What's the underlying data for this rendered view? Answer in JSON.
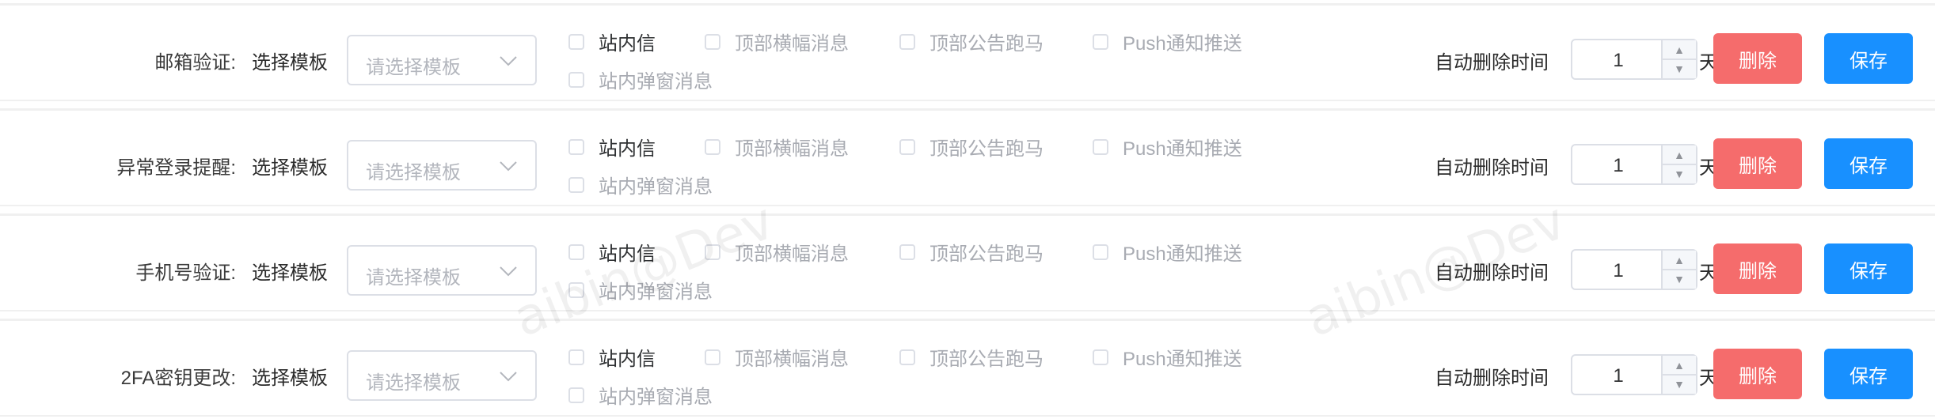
{
  "rows": [
    {
      "label": "邮箱验证:"
    },
    {
      "label": "异常登录提醒:"
    },
    {
      "label": "手机号验证:"
    },
    {
      "label": "2FA密钥更改:"
    }
  ],
  "common": {
    "template_label": "选择模板",
    "template_placeholder": "请选择模板",
    "options": [
      "站内信",
      "顶部横幅消息",
      "顶部公告跑马",
      "Push通知推送",
      "站内弹窗消息"
    ],
    "auto_delete_label": "自动删除时间",
    "auto_delete_value": "1",
    "unit": "天",
    "delete_button": "删除",
    "save_button": "保存"
  },
  "watermark": "aibin@Dev",
  "colors": {
    "delete": "#f56c6c",
    "save": "#1890ff",
    "border": "#dcdfe6"
  }
}
